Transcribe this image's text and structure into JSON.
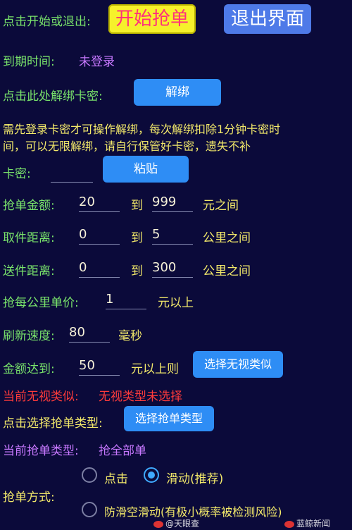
{
  "row1": {
    "label": "点击开始或退出:",
    "start": "开始抢单",
    "exit": "退出界面"
  },
  "expiry": {
    "label": "到期时间:",
    "value": "未登录"
  },
  "unbind": {
    "label": "点击此处解绑卡密:",
    "button": "解绑"
  },
  "notice": {
    "line1": "需先登录卡密才可操作解绑，每次解绑扣除1分钟卡密时",
    "line2": "间，可以无限解绑，请自行保管好卡密，遗失不补"
  },
  "card": {
    "label": "卡密:",
    "value": "",
    "paste": "粘贴"
  },
  "amount": {
    "label": "抢单金额:",
    "min": "20",
    "to": "到",
    "max": "999",
    "unit": "元之间"
  },
  "pickup": {
    "label": "取件距离:",
    "min": "0",
    "to": "到",
    "max": "5",
    "unit": "公里之间"
  },
  "delivery": {
    "label": "送件距离:",
    "min": "0",
    "to": "到",
    "max": "300",
    "unit": "公里之间"
  },
  "perkm": {
    "label": "抢每公里单价:",
    "value": "1",
    "unit": "元以上"
  },
  "refresh": {
    "label": "刷新速度:",
    "value": "80",
    "unit": "毫秒"
  },
  "threshold": {
    "label": "金额达到:",
    "value": "50",
    "unit": "元以上则",
    "button": "选择无视类似"
  },
  "ignore_status": {
    "label": "当前无视类似:",
    "value": "无视类型未选择"
  },
  "type_select": {
    "label": "点击选择抢单类型:",
    "button": "选择抢单类型"
  },
  "type_status": {
    "label": "当前抢单类型:",
    "value": "抢全部单"
  },
  "mode": {
    "label": "抢单方式:",
    "options": [
      "点击",
      "滑动(推荐)",
      "防滑空滑动(有极小概率被检测风险)"
    ],
    "selected": "滑动(推荐)"
  },
  "watermarks": {
    "left": "@天眼查",
    "right": "蓝鲸新闻"
  },
  "colors": {
    "background": "#0b0a3a",
    "green": "#79e36b",
    "yellow": "#f2e86a",
    "purple": "#c778ff",
    "red": "#ff3b3b",
    "button_blue": "#2e8df5"
  }
}
